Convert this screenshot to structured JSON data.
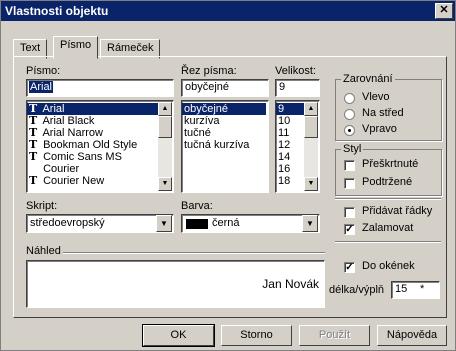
{
  "window": {
    "title": "Vlastnosti objektu",
    "close_icon": "close-icon"
  },
  "tabs": [
    {
      "label": "Text"
    },
    {
      "label": "Písmo"
    },
    {
      "label": "Rámeček"
    }
  ],
  "font": {
    "label": "Písmo:",
    "value": "Arial",
    "items": [
      "Arial",
      "Arial Black",
      "Arial Narrow",
      "Bookman Old Style",
      "Comic Sans MS",
      "Courier",
      "Courier New"
    ],
    "selected": "Arial"
  },
  "style": {
    "label": "Řez písma:",
    "value": "obyčejné",
    "items": [
      "obyčejné",
      "kurzíva",
      "tučné",
      "tučná kurzíva"
    ],
    "selected": "obyčejné"
  },
  "size": {
    "label": "Velikost:",
    "value": "9",
    "items": [
      "9",
      "10",
      "11",
      "12",
      "14",
      "16",
      "18"
    ],
    "selected": "9"
  },
  "script": {
    "label": "Skript:",
    "value": "středoevropský"
  },
  "color": {
    "label": "Barva:",
    "value": "černá",
    "swatch": "#000000"
  },
  "alignment": {
    "label": "Zarovnání",
    "options": [
      "Vlevo",
      "Na střed",
      "Vpravo"
    ],
    "selected": "Vpravo"
  },
  "styl": {
    "label": "Styl",
    "strike": {
      "label": "Přeškrtnuté",
      "checked": false
    },
    "underline": {
      "label": "Podtržené",
      "checked": false
    }
  },
  "lines": {
    "add_lines": {
      "label": "Přidávat řádky",
      "checked": false
    },
    "wrap": {
      "label": "Zalamovat",
      "checked": true
    }
  },
  "preview": {
    "label": "Náhled",
    "text": "Jan Novák"
  },
  "boxes": {
    "do_okenek": {
      "label": "Do okének",
      "checked": true
    },
    "length_label": "délka/výplň",
    "length_value": "15",
    "fill_value": "*"
  },
  "buttons": {
    "ok": "OK",
    "cancel": "Storno",
    "apply": "Použít",
    "help": "Nápověda"
  }
}
